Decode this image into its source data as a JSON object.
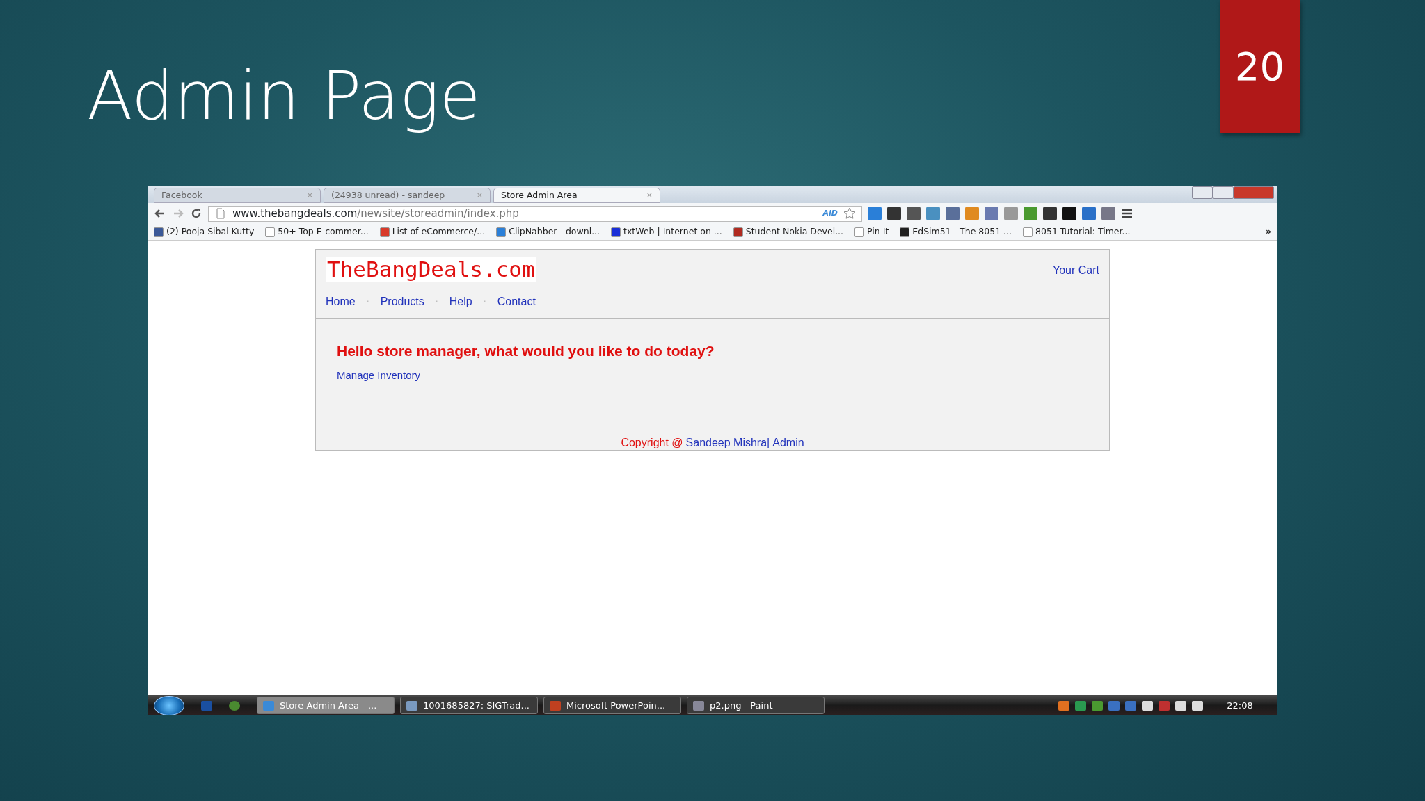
{
  "slide": {
    "title": "Admin Page",
    "page_number": "20"
  },
  "browser": {
    "tabs": [
      {
        "title": "Facebook",
        "close": "×",
        "selected": false
      },
      {
        "title": "(24938 unread) - sandeep",
        "close": "×",
        "selected": false
      },
      {
        "title": "Store Admin Area",
        "close": "×",
        "selected": true
      }
    ],
    "address": {
      "host": "www.thebangdeals.com",
      "path": "/newsite/storeadmin/index.php"
    },
    "extension_label": "AlD",
    "bookmarks": [
      {
        "label": "(2) Pooja Sibal Kutty",
        "color": "#3b5998"
      },
      {
        "label": "50+ Top E-commer...",
        "color": "#ffffff"
      },
      {
        "label": "List of eCommerce/...",
        "color": "#d83a2a"
      },
      {
        "label": "ClipNabber - downl...",
        "color": "#2a7fd8"
      },
      {
        "label": "txtWeb | Internet on ...",
        "color": "#1a2fd8"
      },
      {
        "label": "Student Nokia Devel...",
        "color": "#b02a20"
      },
      {
        "label": "Pin It",
        "color": "#ffffff"
      },
      {
        "label": "EdSim51 - The 8051 ...",
        "color": "#202020"
      },
      {
        "label": "8051 Tutorial: Timer...",
        "color": "#ffffff"
      }
    ],
    "bookmark_overflow": "»",
    "page": {
      "logo": "TheBangDeals.com",
      "cart": "Your Cart",
      "nav": [
        "Home",
        "Products",
        "Help",
        "Contact"
      ],
      "nav_separators": [
        "·",
        "·",
        "·"
      ],
      "heading": "Hello store manager, what would you like to do today?",
      "link": "Manage Inventory",
      "footer": {
        "copyright": "Copyright @",
        "author": "Sandeep Mishra|",
        "admin": "Admin"
      }
    },
    "taskbar": {
      "buttons": [
        {
          "label": "Store Admin Area - ...",
          "selected": true
        },
        {
          "label": "1001685827: SIGTrad...",
          "selected": false
        },
        {
          "label": "Microsoft PowerPoin...",
          "selected": false
        },
        {
          "label": "p2.png - Paint",
          "selected": false
        }
      ],
      "clock": "22:08"
    }
  }
}
